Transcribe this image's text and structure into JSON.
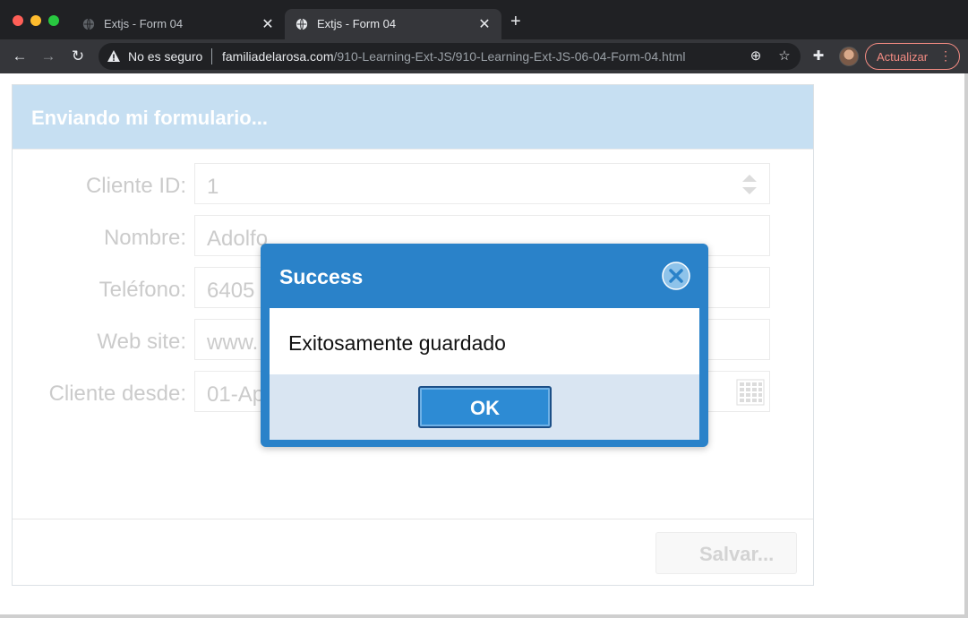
{
  "browser": {
    "tabs": [
      {
        "title": "Extjs - Form 04",
        "active": false
      },
      {
        "title": "Extjs - Form 04",
        "active": true
      }
    ],
    "security_text": "No es seguro",
    "url_host": "familiadelarosa.com",
    "url_path": "/910-Learning-Ext-JS/910-Learning-Ext-JS-06-04-Form-04.html",
    "update_label": "Actualizar"
  },
  "form": {
    "title": "Enviando mi formulario...",
    "fields": [
      {
        "label": "Cliente ID:",
        "value": "1"
      },
      {
        "label": "Nombre:",
        "value": "Adolfo"
      },
      {
        "label": "Teléfono:",
        "value": "6405"
      },
      {
        "label": "Web site:",
        "value": "www."
      },
      {
        "label": "Cliente desde:",
        "value": "01-Ap"
      }
    ],
    "save_label": "Salvar..."
  },
  "dialog": {
    "title": "Success",
    "message": "Exitosamente guardado",
    "ok_label": "OK"
  },
  "colors": {
    "header_bg": "#b0d3ee",
    "dialog_blue": "#2a82c9",
    "update_red": "#f28b82"
  }
}
